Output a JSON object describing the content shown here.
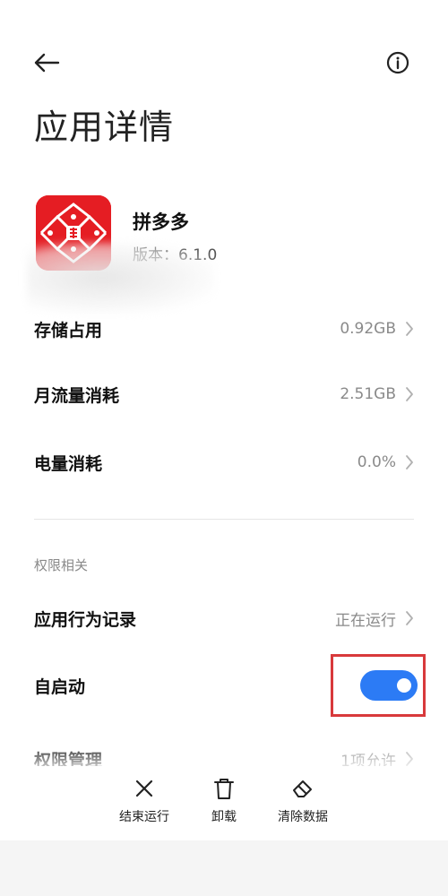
{
  "header": {
    "back_icon": "arrow-left-icon",
    "info_icon": "info-circle-icon",
    "title": "应用详情"
  },
  "app": {
    "name": "拼多多",
    "version": "版本：6.1.0",
    "icon": "pinduoduo-app-icon",
    "brand_color": "#e51d23"
  },
  "usage": [
    {
      "label": "存储占用",
      "value": "0.92GB"
    },
    {
      "label": "月流量消耗",
      "value": "2.51GB"
    },
    {
      "label": "电量消耗",
      "value": "0.0%"
    }
  ],
  "permissions": {
    "section_label": "权限相关",
    "behavior": {
      "label": "应用行为记录",
      "value": "正在运行"
    },
    "autostart": {
      "label": "自启动",
      "enabled": true,
      "toggle_color": "#2c7bf5"
    },
    "manage": {
      "label": "权限管理",
      "value": "1项允许"
    }
  },
  "highlight_color": "#d8393b",
  "actions": [
    {
      "label": "结束运行",
      "icon": "close-x-icon"
    },
    {
      "label": "卸载",
      "icon": "trash-icon"
    },
    {
      "label": "清除数据",
      "icon": "eraser-icon"
    }
  ]
}
